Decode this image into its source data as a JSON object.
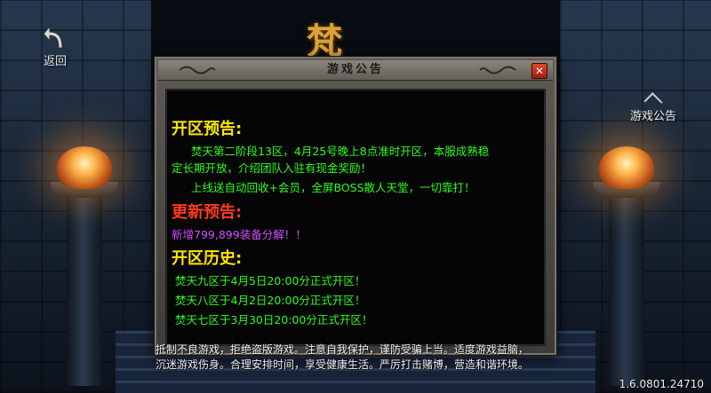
{
  "back": {
    "label": "返回"
  },
  "notice_button": {
    "label": "游戏公告"
  },
  "dialog": {
    "title": "游戏公告",
    "close_symbol": "✕",
    "sections": {
      "open_preview": {
        "title": "开区预告:",
        "lines": [
          "焚天第二阶段13区，4月25号晚上8点准时开区，本服成熟稳",
          "定长期开放，介绍团队入驻有现金奖励！",
          "上线送自动回收+会员，全屏BOSS散人天堂，一切靠打！"
        ]
      },
      "update_preview": {
        "title": "更新预告:",
        "lines": [
          "新增799,899装备分解！！"
        ]
      },
      "open_history": {
        "title": "开区历史:",
        "lines": [
          "焚天九区于4月5日20:00分正式开区！",
          "焚天八区于4月2日20:00分正式开区！",
          "焚天七区于3月30日20:00分正式开区！"
        ]
      }
    }
  },
  "disclaimer": {
    "line1": "抵制不良游戏，拒绝盗版游戏。注意自我保护，谨防受骗上当。适度游戏益脑，",
    "line2": "沉迷游戏伤身。合理安排时间，享受健康生活。严厉打击赌博，营造和谐环境。"
  },
  "version": "1.6.0801.24710",
  "colors": {
    "section_title_yellow": "#ffe600",
    "section_title_red": "#ff3b1a",
    "text_green": "#2dff1e",
    "text_purple": "#d14dff"
  }
}
